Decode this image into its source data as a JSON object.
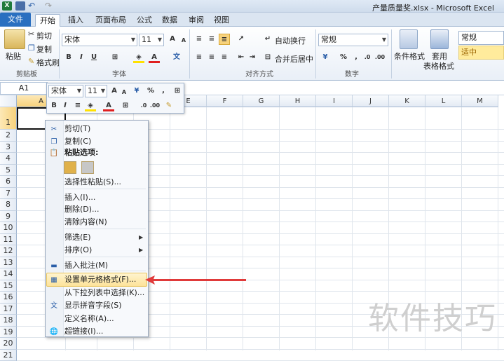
{
  "title": "产量质量奖.xlsx - Microsoft Excel",
  "tabs": [
    "文件",
    "开始",
    "插入",
    "页面布局",
    "公式",
    "数据",
    "审阅",
    "视图"
  ],
  "ribbon": {
    "clipboard": {
      "paste": "粘贴",
      "cut": "剪切",
      "copy": "复制",
      "painter": "格式刷",
      "label": "剪贴板"
    },
    "font": {
      "name": "宋体",
      "size": "11",
      "label": "字体"
    },
    "align": {
      "wrap": "自动换行",
      "merge": "合并后居中",
      "label": "对齐方式"
    },
    "number": {
      "format": "常规",
      "label": "数字"
    },
    "styles": {
      "cond": "条件格式",
      "table1": "套用",
      "table2": "表格格式",
      "normal": "常规",
      "good": "适中"
    }
  },
  "namebox": "A1",
  "mini": {
    "font": "宋体",
    "size": "11"
  },
  "columns": [
    "A",
    "B",
    "C",
    "D",
    "E",
    "F",
    "G",
    "H",
    "I",
    "J",
    "K",
    "L",
    "M"
  ],
  "rows": [
    "1",
    "2",
    "3",
    "4",
    "5",
    "6",
    "7",
    "8",
    "9",
    "10",
    "11",
    "12",
    "13",
    "14",
    "15",
    "16",
    "17",
    "18",
    "19",
    "20",
    "21"
  ],
  "menu": {
    "cut": "剪切(T)",
    "copy": "复制(C)",
    "paste_opts": "粘贴选项:",
    "paste_special": "选择性粘贴(S)...",
    "insert": "插入(I)...",
    "delete": "删除(D)...",
    "clear": "清除内容(N)",
    "filter": "筛选(E)",
    "sort": "排序(O)",
    "comment": "插入批注(M)",
    "format_cells": "设置单元格格式(F)...",
    "pick_list": "从下拉列表中选择(K)...",
    "phonetic": "显示拼音字段(S)",
    "define_name": "定义名称(A)...",
    "hyperlink": "超链接(I)..."
  },
  "watermark": "软件技巧",
  "colors": {
    "accent": "#2a6fc0",
    "highlight": "#fde39a",
    "arrow": "#e03a3a"
  }
}
